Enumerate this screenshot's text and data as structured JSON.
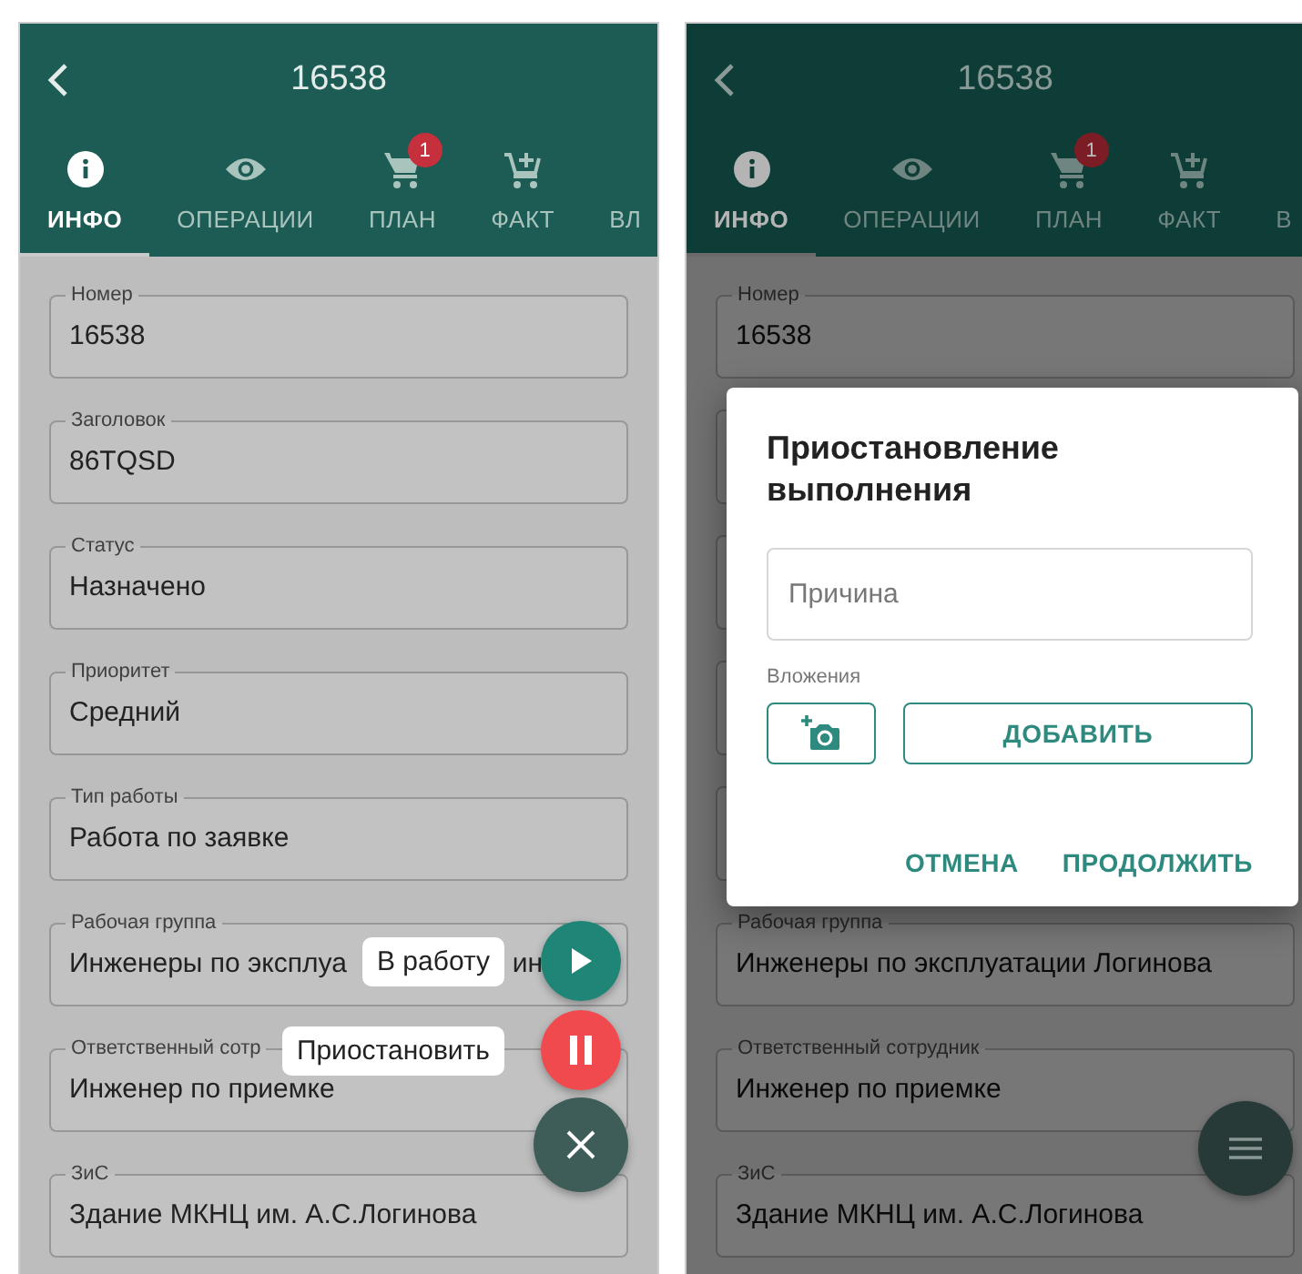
{
  "screens": [
    {
      "title": "16538",
      "tabs": [
        {
          "label": "ИНФО",
          "kind": "info",
          "selected": true
        },
        {
          "label": "ОПЕРАЦИИ",
          "kind": "view",
          "selected": false
        },
        {
          "label": "ПЛАН",
          "kind": "plan",
          "selected": false,
          "badge": "1"
        },
        {
          "label": "ФАКТ",
          "kind": "fact",
          "selected": false
        },
        {
          "label": "ВЛ",
          "kind": "plain",
          "selected": false
        }
      ],
      "fields": [
        {
          "label": "Номер",
          "value": "16538"
        },
        {
          "label": "Заголовок",
          "value": "86TQSD"
        },
        {
          "label": "Статус",
          "value": "Назначено"
        },
        {
          "label": "Приоритет",
          "value": "Средний"
        },
        {
          "label": "Тип работы",
          "value": "Работа по заявке"
        },
        {
          "label": "Рабочая группа",
          "value": "Инженеры по эксплуа",
          "value_tail": "ин"
        },
        {
          "label": "Ответственный сотр",
          "value": "Инженер по приемке"
        },
        {
          "label": "ЗиС",
          "value": "Здание МКНЦ им. А.С.Логинова"
        }
      ],
      "fab_actions": [
        {
          "label": "В работу",
          "kind": "play"
        },
        {
          "label": "Приостановить",
          "kind": "pause"
        }
      ]
    },
    {
      "title": "16538",
      "tabs": [
        {
          "label": "ИНФО",
          "kind": "info",
          "selected": true
        },
        {
          "label": "ОПЕРАЦИИ",
          "kind": "view",
          "selected": false
        },
        {
          "label": "ПЛАН",
          "kind": "plan",
          "selected": false,
          "badge": "1"
        },
        {
          "label": "ФАКТ",
          "kind": "fact",
          "selected": false
        },
        {
          "label": "В",
          "kind": "plain",
          "selected": false
        }
      ],
      "fields": [
        {
          "label": "Номер",
          "value": "16538"
        },
        {
          "label": "Рабочая группа",
          "value": "Инженеры по эксплуатации Логинова"
        },
        {
          "label": "Ответственный сотрудник",
          "value": "Инженер по приемке"
        },
        {
          "label": "ЗиС",
          "value": "Здание МКНЦ им. А.С.Логинова"
        }
      ],
      "dialog": {
        "title": "Приостановление выполнения",
        "reason_field": {
          "placeholder": "Причина"
        },
        "attachments_label": "Вложения",
        "add_button": "ДОБАВИТЬ",
        "actions": [
          "ОТМЕНА",
          "ПРОДОЛЖИТЬ"
        ]
      }
    }
  ]
}
